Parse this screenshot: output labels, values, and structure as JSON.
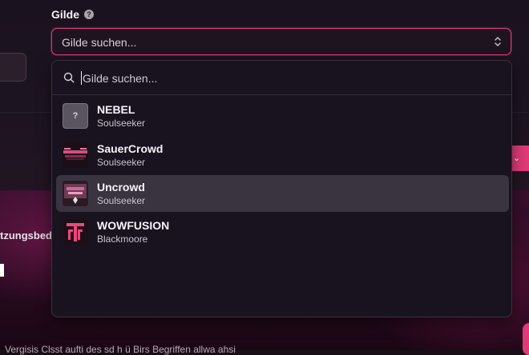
{
  "field": {
    "label": "Gilde",
    "help_icon": "?",
    "placeholder": "Gilde suchen..."
  },
  "dropdown": {
    "search_placeholder": "Gilde suchen...",
    "options": [
      {
        "name": "NEBEL",
        "realm": "Soulseeker",
        "icon": "question-placeholder",
        "highlighted": false
      },
      {
        "name": "SauerCrowd",
        "realm": "Soulseeker",
        "icon": "guild-banner",
        "highlighted": false
      },
      {
        "name": "Uncrowd",
        "realm": "Soulseeker",
        "icon": "guild-emblem",
        "highlighted": true
      },
      {
        "name": "WOWFUSION",
        "realm": "Blackmoore",
        "icon": "tf-logo",
        "highlighted": false
      }
    ]
  },
  "background": {
    "left_text": "tzungsbedi",
    "bottom_text": "Vergisis Clsst    aufti      des sd    h    ü Birs   Begriffen        allwa    ahsi"
  },
  "colors": {
    "accent": "#e03a78",
    "panel": "#191320",
    "highlight": "#3a3441"
  }
}
